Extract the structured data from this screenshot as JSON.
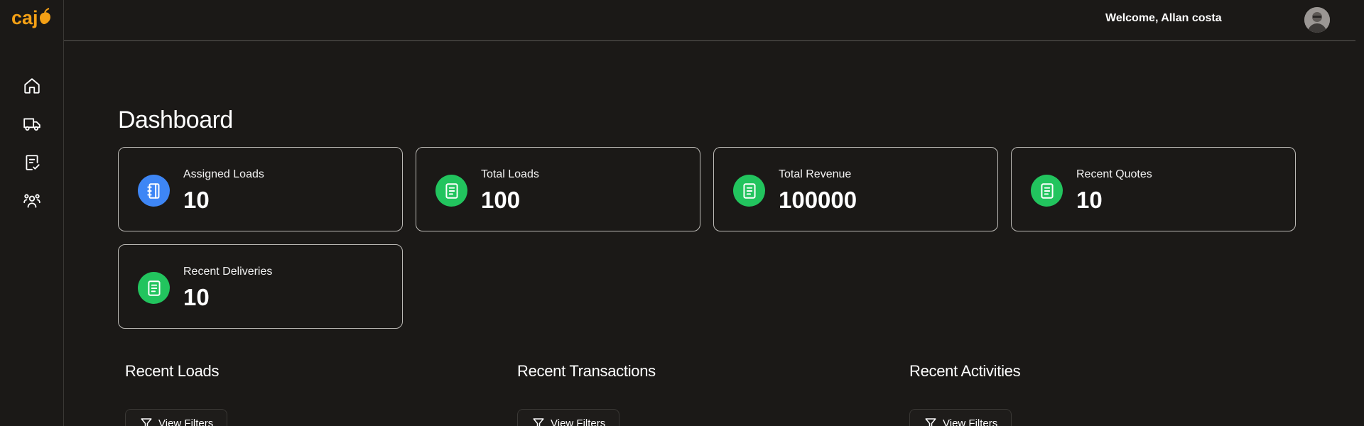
{
  "app": {
    "logo_text": "caj",
    "brand_color": "#f4a015"
  },
  "sidebar": {
    "items": [
      {
        "name": "home",
        "icon": "home-icon"
      },
      {
        "name": "loads",
        "icon": "truck-icon"
      },
      {
        "name": "quotes",
        "icon": "clipboard-check-icon"
      },
      {
        "name": "users",
        "icon": "users-icon"
      }
    ]
  },
  "header": {
    "welcome": "Welcome, Allan costa",
    "avatar_icon": "user-avatar"
  },
  "main": {
    "title": "Dashboard",
    "cards": [
      {
        "label": "Assigned Loads",
        "value": "10",
        "icon": "notebook-icon",
        "color": "#3e86f5"
      },
      {
        "label": "Total Loads",
        "value": "100",
        "icon": "document-icon",
        "color": "#22c45e"
      },
      {
        "label": "Total Revenue",
        "value": "100000",
        "icon": "document-icon",
        "color": "#22c45e"
      },
      {
        "label": "Recent Quotes",
        "value": "10",
        "icon": "document-icon",
        "color": "#22c45e"
      },
      {
        "label": "Recent Deliveries",
        "value": "10",
        "icon": "document-icon",
        "color": "#22c45e"
      }
    ],
    "sections": [
      {
        "title": "Recent Loads",
        "filter_label": "View Filters"
      },
      {
        "title": "Recent Transactions",
        "filter_label": "View Filters"
      },
      {
        "title": "Recent Activities",
        "filter_label": "View Filters"
      }
    ]
  }
}
